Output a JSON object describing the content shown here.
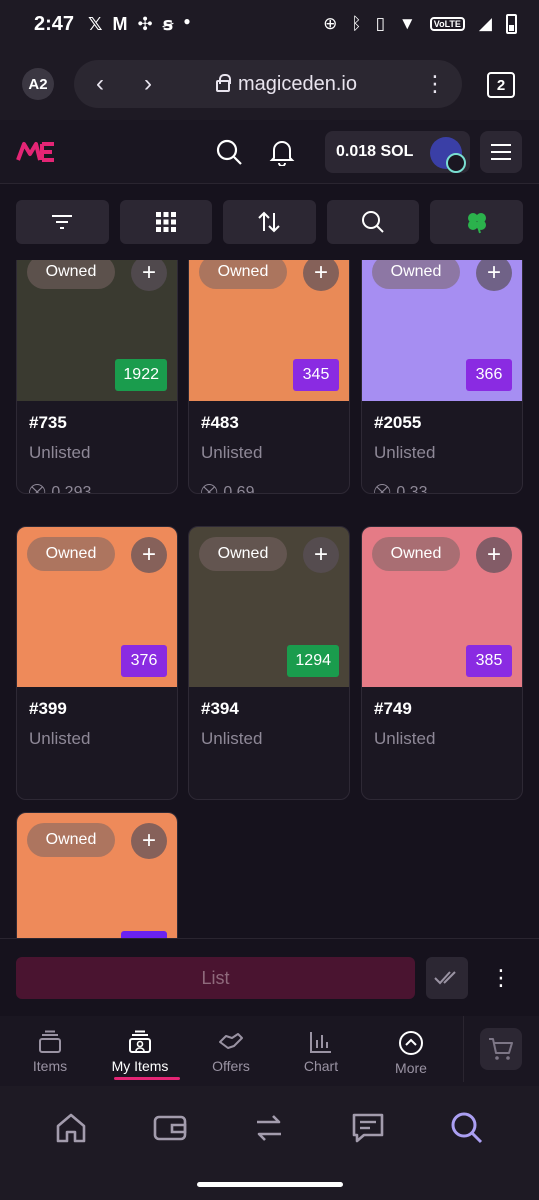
{
  "status_bar": {
    "time": "2:47",
    "left_icons": [
      "x-icon",
      "gmail-icon",
      "pinwheel-icon",
      "s-icon",
      "dot-icon"
    ],
    "volte": "VoLTE"
  },
  "browser": {
    "profile": "A2",
    "url": "magiceden.io",
    "tab_count": "2"
  },
  "header": {
    "balance": "0.018 SOL"
  },
  "cards": [
    {
      "owned": "Owned",
      "rank": "1922",
      "rank_color": "#1a9c4d",
      "name": "#735",
      "status": "Unlisted",
      "price": "0.293",
      "bg": "#3a3a30"
    },
    {
      "owned": "Owned",
      "rank": "345",
      "rank_color": "#8a2be2",
      "name": "#483",
      "status": "Unlisted",
      "price": "0.69",
      "bg": "#e98a57"
    },
    {
      "owned": "Owned",
      "rank": "366",
      "rank_color": "#8a2be2",
      "name": "#2055",
      "status": "Unlisted",
      "price": "0.33",
      "bg": "#a68ef2"
    },
    {
      "owned": "Owned",
      "rank": "376",
      "rank_color": "#8a2be2",
      "name": "#399",
      "status": "Unlisted",
      "price": "",
      "bg": "#ee8a5a"
    },
    {
      "owned": "Owned",
      "rank": "1294",
      "rank_color": "#1a9c4d",
      "name": "#394",
      "status": "Unlisted",
      "price": "",
      "bg": "#4a4438"
    },
    {
      "owned": "Owned",
      "rank": "385",
      "rank_color": "#8a2be2",
      "name": "#749",
      "status": "Unlisted",
      "price": "",
      "bg": "#e57b86"
    },
    {
      "owned": "Owned",
      "rank": "",
      "rank_color": "#8a2be2",
      "name": "",
      "status": "",
      "price": "",
      "bg": "#ee8a5a"
    }
  ],
  "actions": {
    "list_label": "List"
  },
  "app_nav": [
    {
      "label": "Items",
      "icon": "items-icon"
    },
    {
      "label": "My Items",
      "icon": "my-items-icon"
    },
    {
      "label": "Offers",
      "icon": "offers-icon"
    },
    {
      "label": "Chart",
      "icon": "chart-icon"
    },
    {
      "label": "More",
      "icon": "more-icon"
    }
  ],
  "colors": {
    "accent": "#e42575",
    "background": "#16121d",
    "panel": "#2c2733"
  }
}
